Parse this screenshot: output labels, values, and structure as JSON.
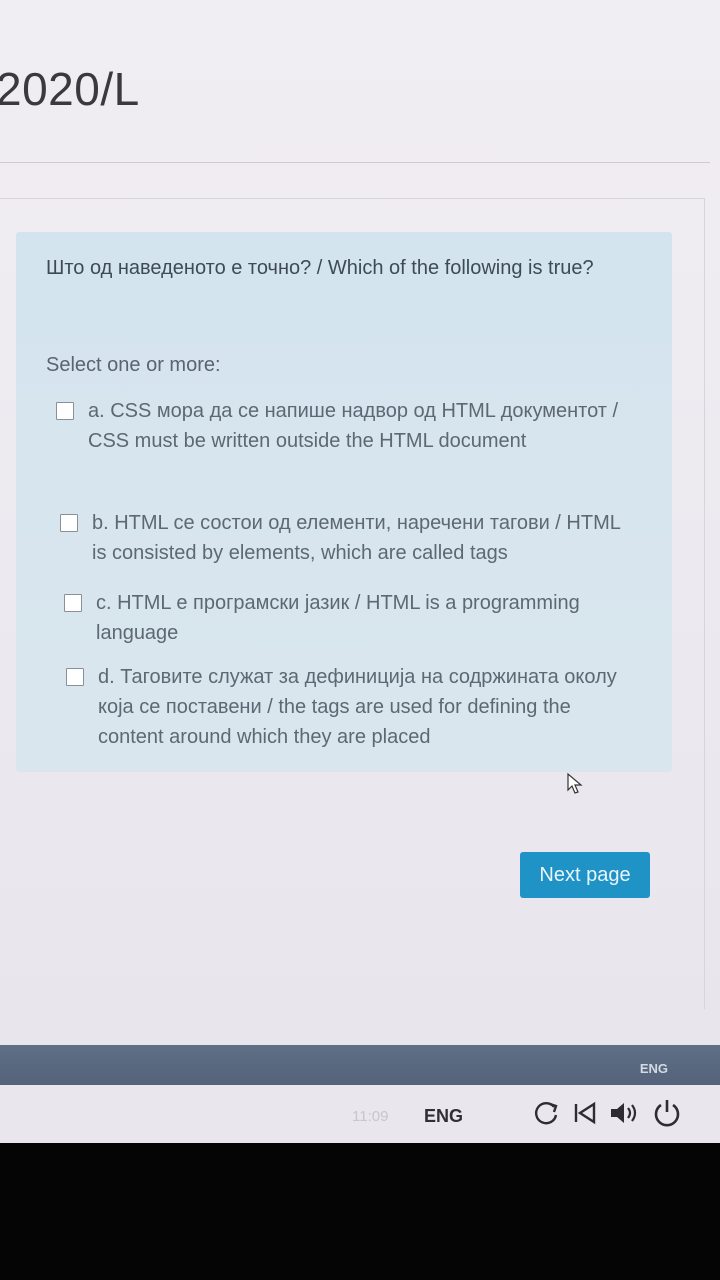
{
  "course": {
    "title": "2020/L"
  },
  "question": {
    "text": "Што од наведеното е точно? / Which of the following is true?",
    "prompt": "Select one or more:",
    "options": [
      {
        "text": "a. CSS мора да се напише надвор од HTML документот / CSS must be written outside the HTML document",
        "checked": false
      },
      {
        "text": "b. HTML се состои од елементи, наречени тагови / HTML is consisted by elements, which are called tags",
        "checked": false
      },
      {
        "text": "c. HTML е програмски јазик / HTML is a programming language",
        "checked": false
      },
      {
        "text": "d. Таговите служат за дефиниција на содржината околу која се поставени / the tags are used for defining the content around which they are placed",
        "checked": false
      }
    ]
  },
  "navigation": {
    "next_label": "Next page"
  },
  "taskbar": {
    "lang": "ENG",
    "time": "11:09",
    "tray_lang": "ENG"
  },
  "colors": {
    "question_bg": "#d6e5ef",
    "button_bg": "#1f93c6",
    "taskbar_bg": "#5a6a80"
  }
}
